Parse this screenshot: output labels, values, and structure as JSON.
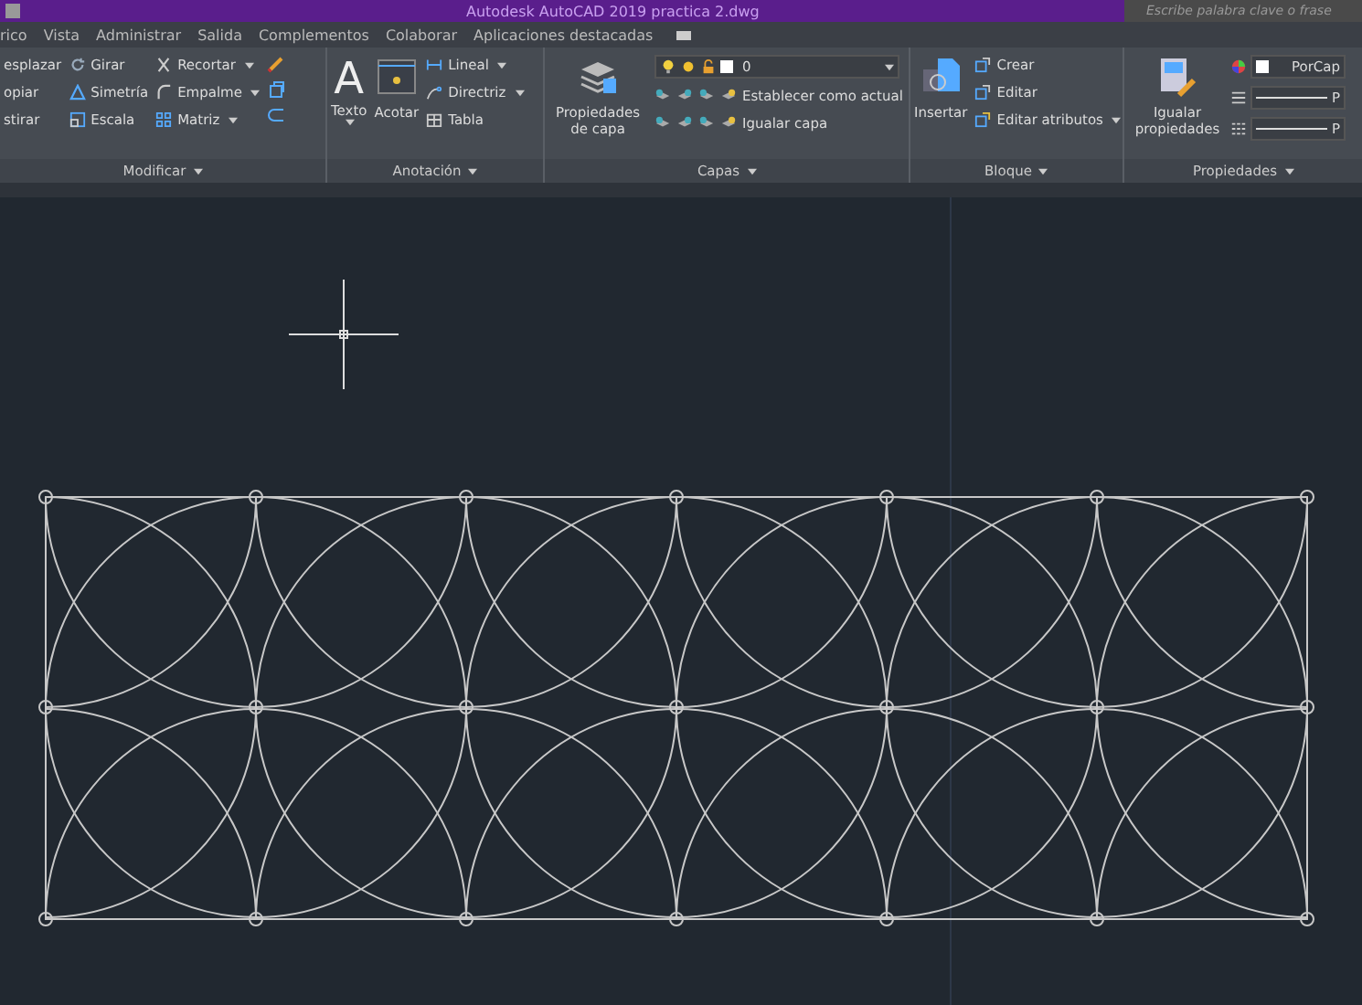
{
  "window": {
    "title": "Autodesk AutoCAD 2019    practica 2.dwg",
    "search": {
      "placeholder": "Escribe palabra clave o frase"
    }
  },
  "menu_tabs": [
    "rico",
    "Vista",
    "Administrar",
    "Salida",
    "Complementos",
    "Colaborar",
    "Aplicaciones destacadas"
  ],
  "ribbon": {
    "modificar": {
      "label": "Modificar",
      "rows": [
        [
          {
            "label": "esplazar",
            "dropdown": false
          },
          {
            "label": "Girar",
            "dropdown": false
          },
          {
            "label": "Recortar",
            "dropdown": true
          }
        ],
        [
          {
            "label": "opiar",
            "dropdown": false
          },
          {
            "label": "Simetría",
            "dropdown": false
          },
          {
            "label": "Empalme",
            "dropdown": true
          }
        ],
        [
          {
            "label": "stirar",
            "dropdown": false
          },
          {
            "label": "Escala",
            "dropdown": false
          },
          {
            "label": "Matriz",
            "dropdown": true
          }
        ]
      ]
    },
    "anotacion": {
      "label": "Anotación",
      "big": [
        {
          "glyph": "A",
          "label": "Texto",
          "dropdown": true
        },
        {
          "label": "Acotar",
          "dropdown": false
        }
      ],
      "small": [
        {
          "label": "Lineal",
          "dropdown": true
        },
        {
          "label": "Directriz",
          "dropdown": true
        },
        {
          "label": "Tabla",
          "dropdown": false
        }
      ]
    },
    "capas": {
      "label": "Capas",
      "big": "Propiedades de capa",
      "layer": "0",
      "small": [
        "Establecer como actual",
        "Igualar capa"
      ]
    },
    "bloque": {
      "label": "Bloque",
      "big": "Insertar",
      "small": [
        {
          "label": "Crear",
          "dropdown": false
        },
        {
          "label": "Editar",
          "dropdown": false
        },
        {
          "label": "Editar atributos",
          "dropdown": true
        }
      ]
    },
    "propiedades": {
      "label": "Propiedades",
      "big": "Igualar propiedades",
      "color_setting": "PorCap",
      "lines": [
        "P",
        "P"
      ]
    }
  }
}
